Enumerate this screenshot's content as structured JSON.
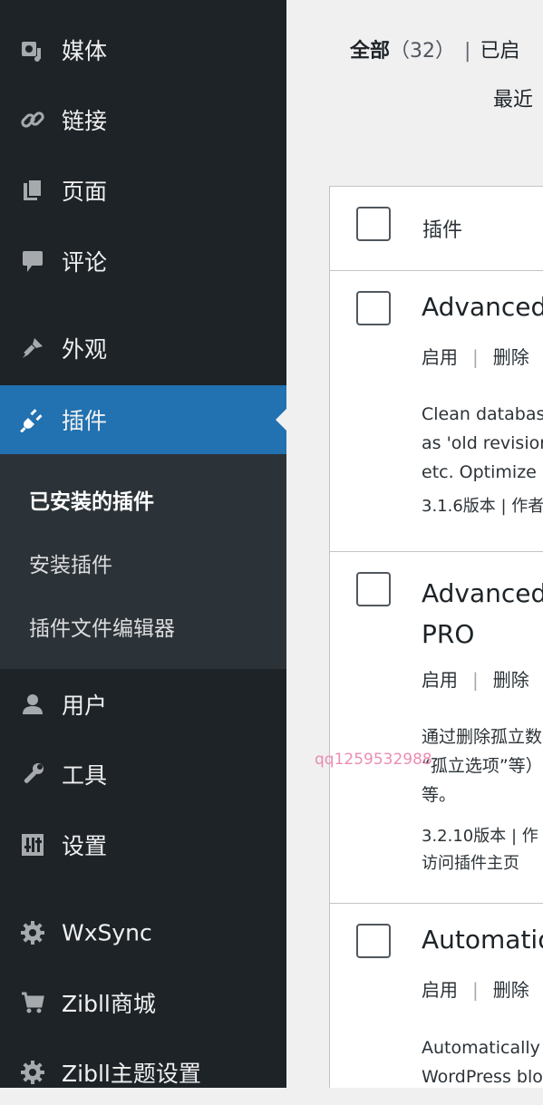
{
  "sidebar": {
    "items": [
      {
        "label": "媒体",
        "icon": "media-icon"
      },
      {
        "label": "链接",
        "icon": "link-icon"
      },
      {
        "label": "页面",
        "icon": "pages-icon"
      },
      {
        "label": "评论",
        "icon": "comments-icon"
      },
      {
        "label": "外观",
        "icon": "appearance-icon"
      },
      {
        "label": "插件",
        "icon": "plugin-icon",
        "active": true
      },
      {
        "label": "用户",
        "icon": "users-icon"
      },
      {
        "label": "工具",
        "icon": "tools-icon"
      },
      {
        "label": "设置",
        "icon": "settings-icon"
      },
      {
        "label": "WxSync",
        "icon": "gear-icon"
      },
      {
        "label": "Zibll商城",
        "icon": "cart-icon"
      },
      {
        "label": "Zibll主题设置",
        "icon": "gear-icon"
      }
    ],
    "submenu": [
      {
        "label": "已安装的插件",
        "current": true
      },
      {
        "label": "安装插件"
      },
      {
        "label": "插件文件编辑器"
      }
    ]
  },
  "filters": {
    "all_label": "全部",
    "all_count": "（32）",
    "separator": "|",
    "active_label": "已启",
    "recent_label": "最近"
  },
  "table": {
    "header_label": "插件",
    "rows": [
      {
        "name_lines": [
          "Advanced"
        ],
        "actions": {
          "activate": "启用",
          "separator": "|",
          "delete": "删除"
        },
        "description_lines": [
          "Clean databas",
          "as 'old revisior",
          "etc. Optimize c"
        ],
        "meta_lines": [
          "3.1.6版本 | 作者"
        ]
      },
      {
        "name_lines": [
          "Advanced",
          "PRO"
        ],
        "actions": {
          "activate": "启用",
          "separator": "|",
          "delete": "删除"
        },
        "description_lines": [
          "通过删除孤立数",
          "“孤立选项”等）",
          "等。"
        ],
        "meta_lines": [
          "3.2.10版本 | 作",
          "访问插件主页"
        ]
      },
      {
        "name_lines": [
          "Automatio"
        ],
        "actions": {
          "activate": "启用",
          "separator": "|",
          "delete": "删除"
        },
        "description_lines": [
          "Automatically",
          "WordPress blo"
        ],
        "meta_lines": []
      }
    ]
  },
  "watermark": "qq1259532988",
  "colors": {
    "sidebar_bg": "#1d2327",
    "submenu_bg": "#2c3338",
    "accent": "#2271b1",
    "content_bg": "#f0f0f1"
  }
}
